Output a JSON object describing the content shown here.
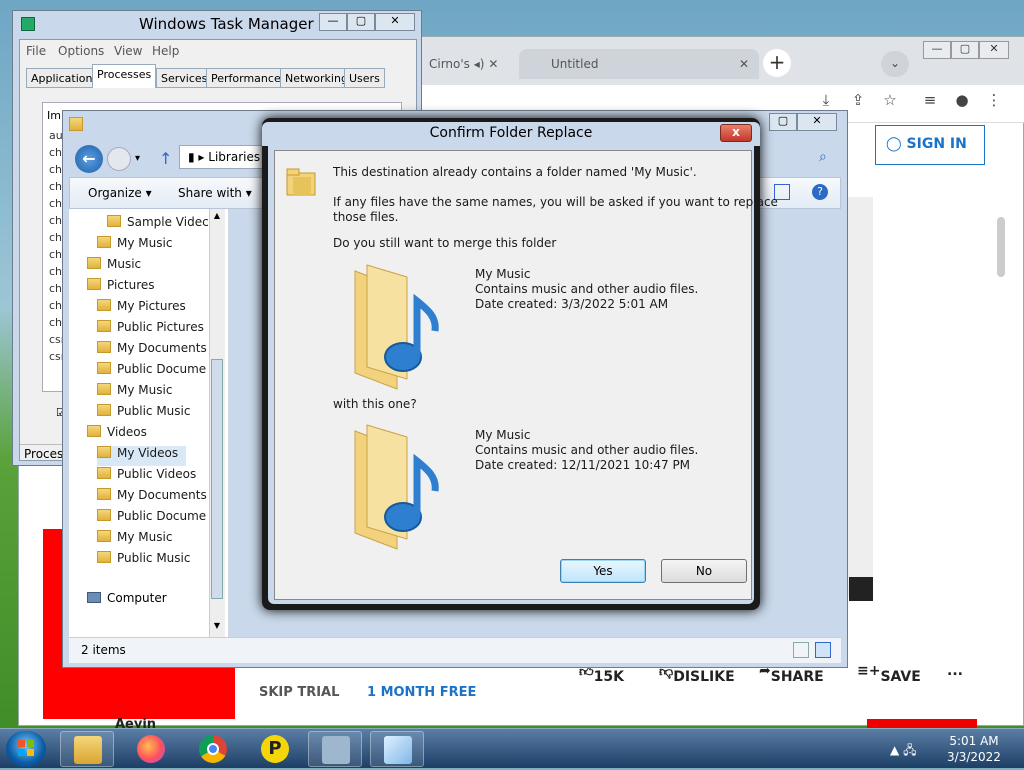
{
  "task_manager": {
    "title": "Windows Task Manager",
    "menu": [
      "File",
      "Options",
      "View",
      "Help"
    ],
    "tabs": [
      "Applications",
      "Processes",
      "Services",
      "Performance",
      "Networking",
      "Users"
    ],
    "column_header": "Im",
    "rows": [
      "au",
      "chi",
      "chi",
      "chi",
      "chi",
      "chi",
      "chi",
      "chi",
      "chi",
      "chi",
      "chi",
      "chi",
      "csr",
      "csr"
    ],
    "checkbox_label": "S",
    "status": "Process"
  },
  "chrome": {
    "tab1": "Cirno's",
    "tab2": "Untitled",
    "new_tab": "+",
    "sign_in": "SIGN IN",
    "actions": {
      "like": "15K",
      "dislike": "DISLIKE",
      "share": "SHARE",
      "save": "SAVE",
      "more": "..."
    },
    "promo": {
      "skip": "SKIP TRIAL",
      "month": "1 MONTH FREE"
    },
    "channel": "Aeyin"
  },
  "explorer": {
    "address": "Libraries",
    "toolbar": {
      "organize": "Organize",
      "share_with": "Share with"
    },
    "tree": [
      {
        "label": "Sample Videc",
        "indent": 2
      },
      {
        "label": "My Music",
        "indent": 1
      },
      {
        "label": "Music",
        "indent": 0
      },
      {
        "label": "Pictures",
        "indent": 0
      },
      {
        "label": "My Pictures",
        "indent": 1
      },
      {
        "label": "Public Pictures",
        "indent": 1
      },
      {
        "label": "My Documents",
        "indent": 1
      },
      {
        "label": "Public Docume",
        "indent": 1
      },
      {
        "label": "My Music",
        "indent": 1
      },
      {
        "label": "Public Music",
        "indent": 1
      },
      {
        "label": "Videos",
        "indent": 0
      },
      {
        "label": "My Videos",
        "indent": 1
      },
      {
        "label": "Public Videos",
        "indent": 1
      },
      {
        "label": "My Documents",
        "indent": 1
      },
      {
        "label": "Public Docume",
        "indent": 1
      },
      {
        "label": "My Music",
        "indent": 1
      },
      {
        "label": "Public Music",
        "indent": 1
      }
    ],
    "computer": "Computer",
    "status": "2 items"
  },
  "dialog": {
    "title": "Confirm Folder Replace",
    "close": "x",
    "line1": "This destination already contains a folder named 'My Music'.",
    "line2a": "If any files have the same names, you will be asked if you want to replace",
    "line2b": "those files.",
    "question": "Do you still want to merge this folder",
    "folder1": {
      "name": "My Music",
      "desc": "Contains music and other audio files.",
      "date": "Date created: 3/3/2022 5:01 AM"
    },
    "with": "with this one?",
    "folder2": {
      "name": "My Music",
      "desc": "Contains music and other audio files.",
      "date": "Date created: 12/11/2021 10:47 PM"
    },
    "yes": "Yes",
    "no": "No"
  },
  "taskbar": {
    "time": "5:01 AM",
    "date": "3/3/2022",
    "apps": [
      "windows-explorer-icon",
      "firefox-icon",
      "chrome-icon",
      "p-app-icon",
      "task-manager-icon",
      "notepad-icon"
    ]
  },
  "colors": {
    "accent": "#1a73c8",
    "dialog_frame": "#c9d8ea",
    "promo_red": "#ff0000"
  }
}
